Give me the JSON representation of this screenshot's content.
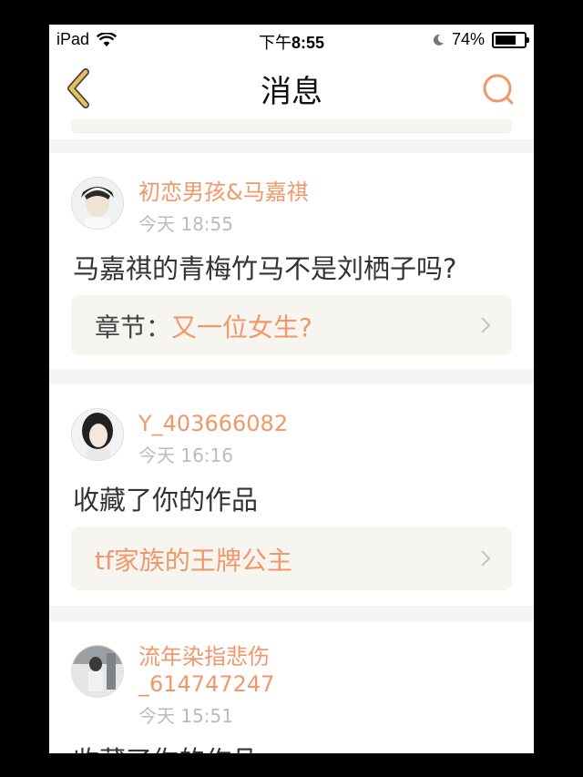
{
  "status_bar": {
    "device": "iPad",
    "time_prefix": "下午",
    "time": "8:55",
    "battery": "74%",
    "battery_level": 0.74
  },
  "nav": {
    "title": "消息",
    "back_icon": "chevron-left-icon",
    "search_icon": "search-icon"
  },
  "messages": [
    {
      "user": "初恋男孩&马嘉祺",
      "time": "今天 18:55",
      "text": "马嘉祺的青梅竹马不是刘栖子吗?",
      "chip_prefix": "章节：",
      "chip_title": "又一位女生?"
    },
    {
      "user": "Y_403666082",
      "time": "今天 16:16",
      "text": "收藏了你的作品",
      "chip_title": "tf家族的王牌公主"
    },
    {
      "user_line1": "流年染指悲伤",
      "user_line2": "_614747247",
      "time": "今天 15:51",
      "text": "收藏了你的作品"
    }
  ],
  "colors": {
    "accent": "#f0986b",
    "back_arrow": "#e8c05a",
    "chip_bg": "#f6f5ef"
  }
}
